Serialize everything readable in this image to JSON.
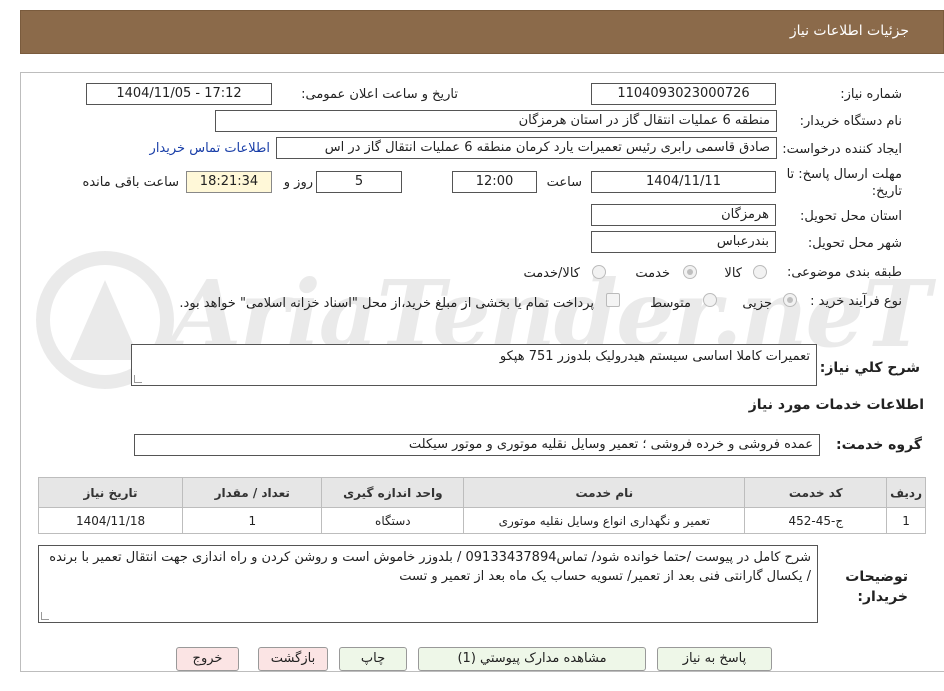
{
  "header": {
    "title": "جزئیات اطلاعات نیاز"
  },
  "fields": {
    "need_number_label": "شماره نیاز:",
    "need_number": "1104093023000726",
    "announce_label": "تاریخ و ساعت اعلان عمومی:",
    "announce_value": "1404/11/05 - 17:12",
    "buyer_org_label": "نام دستگاه خریدار:",
    "buyer_org": "منطقه 6 عملیات انتقال گاز در استان هرمزگان",
    "requester_label": "ایجاد کننده درخواست:",
    "requester": "صادق قاسمی رابری رئیس تعمیرات یارد کرمان منطقه 6 عملیات انتقال گاز در اس",
    "contact_link": "اطلاعات تماس خریدار",
    "deadline_label": "مهلت ارسال پاسخ: تا تاریخ:",
    "deadline_date": "1404/11/11",
    "hour_label": "ساعت",
    "deadline_time": "12:00",
    "days_value": "5",
    "days_label": "روز و",
    "remaining_time": "18:21:34",
    "remaining_label": "ساعت باقی مانده",
    "province_label": "استان محل تحویل:",
    "province": "هرمزگان",
    "city_label": "شهر محل تحویل:",
    "city": "بندرعباس",
    "category_label": "طبقه بندی موضوعی:",
    "category_options": [
      "کالا",
      "خدمت",
      "کالا/خدمت"
    ],
    "process_label": "نوع فرآیند خرید :",
    "process_options": [
      "جزیی",
      "متوسط"
    ],
    "payment_note": "پرداخت تمام یا بخشی از مبلغ خرید،از محل \"اسناد خزانه اسلامی\" خواهد بود."
  },
  "summary": {
    "label": "شرح کلي نياز:",
    "text": "تعمیرات کاملا اساسی سیستم هیدرولیک بلدوزر 751 هپکو"
  },
  "services": {
    "section_title": "اطلاعات خدمات مورد نیاز",
    "group_label": "گروه خدمت:",
    "group_value": "عمده فروشی و خرده فروشی ؛ تعمیر وسایل نقلیه موتوری و موتور سیکلت",
    "columns": [
      "ردیف",
      "کد خدمت",
      "نام خدمت",
      "واحد اندازه گیری",
      "تعداد / مقدار",
      "تاریخ نیاز"
    ],
    "rows": [
      [
        "1",
        "ج-45-452",
        "تعمیر و نگهداری انواع وسایل نقلیه موتوری",
        "دستگاه",
        "1",
        "1404/11/18"
      ]
    ]
  },
  "buyer_notes": {
    "label": "توضیحات خریدار:",
    "text": "شرح کامل در پیوست /حتما خوانده شود/ تماس09133437894 / بلدوزر خاموش است و روشن کردن و راه اندازی جهت انتقال تعمیر با برنده / یکسال گارانتی فنی بعد از تعمیر/ تسویه حساب یک ماه بعد از تعمیر و تست"
  },
  "buttons": {
    "reply": "پاسخ به نیاز",
    "attachments": "مشاهده مدارک پیوستي (1)",
    "print": "چاپ",
    "back": "بازگشت",
    "exit": "خروج"
  },
  "watermark": "AriaTender.neT"
}
